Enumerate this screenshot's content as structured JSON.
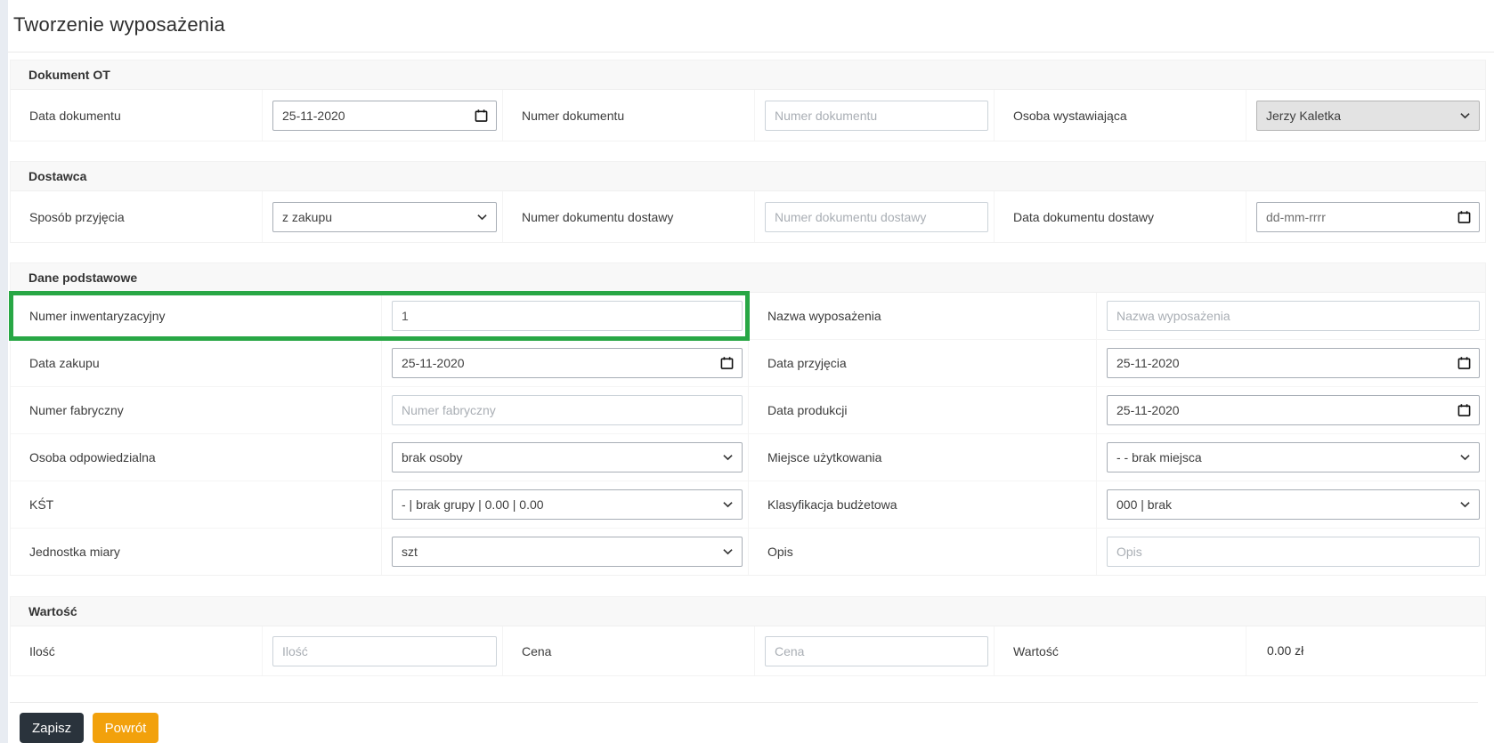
{
  "title": "Tworzenie wyposażenia",
  "sections": {
    "dokumentOT": {
      "title": "Dokument OT",
      "dataDokumentu": {
        "label": "Data dokumentu",
        "value": "25-11-2020"
      },
      "numerDokumentu": {
        "label": "Numer dokumentu",
        "placeholder": "Numer dokumentu"
      },
      "osobaWystawiajaca": {
        "label": "Osoba wystawiająca",
        "value": "Jerzy Kaletka"
      }
    },
    "dostawca": {
      "title": "Dostawca",
      "sposobPrzyjecia": {
        "label": "Sposób przyjęcia",
        "value": "z zakupu"
      },
      "numerDokumentuDostawy": {
        "label": "Numer dokumentu dostawy",
        "placeholder": "Numer dokumentu dostawy"
      },
      "dataDokumentuDostawy": {
        "label": "Data dokumentu dostawy",
        "placeholder": "dd-mm-rrrr"
      }
    },
    "danePodstawowe": {
      "title": "Dane podstawowe",
      "numerInwentaryzacyjny": {
        "label": "Numer inwentaryzacyjny",
        "value": "1"
      },
      "nazwaWyposazenia": {
        "label": "Nazwa wyposażenia",
        "placeholder": "Nazwa wyposażenia"
      },
      "dataZakupu": {
        "label": "Data zakupu",
        "value": "25-11-2020"
      },
      "dataPrzyjecia": {
        "label": "Data przyjęcia",
        "value": "25-11-2020"
      },
      "numerFabryczny": {
        "label": "Numer fabryczny",
        "placeholder": "Numer fabryczny"
      },
      "dataProdukcji": {
        "label": "Data produkcji",
        "value": "25-11-2020"
      },
      "osobaOdpowiedzialna": {
        "label": "Osoba odpowiedzialna",
        "value": "brak osoby"
      },
      "miejsceUzytkowania": {
        "label": "Miejsce użytkowania",
        "value": "- - brak miejsca"
      },
      "kst": {
        "label": "KŚT",
        "value": "- | brak grupy | 0.00 | 0.00"
      },
      "klasyfikacjaBudzetowa": {
        "label": "Klasyfikacja budżetowa",
        "value": "000 | brak"
      },
      "jednostkaMiary": {
        "label": "Jednostka miary",
        "value": "szt"
      },
      "opis": {
        "label": "Opis",
        "placeholder": "Opis"
      }
    },
    "wartosc": {
      "title": "Wartość",
      "ilosc": {
        "label": "Ilość",
        "placeholder": "Ilość"
      },
      "cena": {
        "label": "Cena",
        "placeholder": "Cena"
      },
      "wartosc": {
        "label": "Wartość",
        "value": "0.00 zł"
      }
    }
  },
  "buttons": {
    "zapisz": "Zapisz",
    "powrot": "Powrót"
  },
  "icons": {
    "calendar": "calendar-icon",
    "chevron": "chevron-down-icon"
  },
  "colors": {
    "highlight": "#28a745",
    "saveButton": "#2a333c",
    "backButton": "#f2a10c",
    "sectionHeaderBg": "#f8f8f8",
    "leftStrip": "#e8ecf2"
  }
}
